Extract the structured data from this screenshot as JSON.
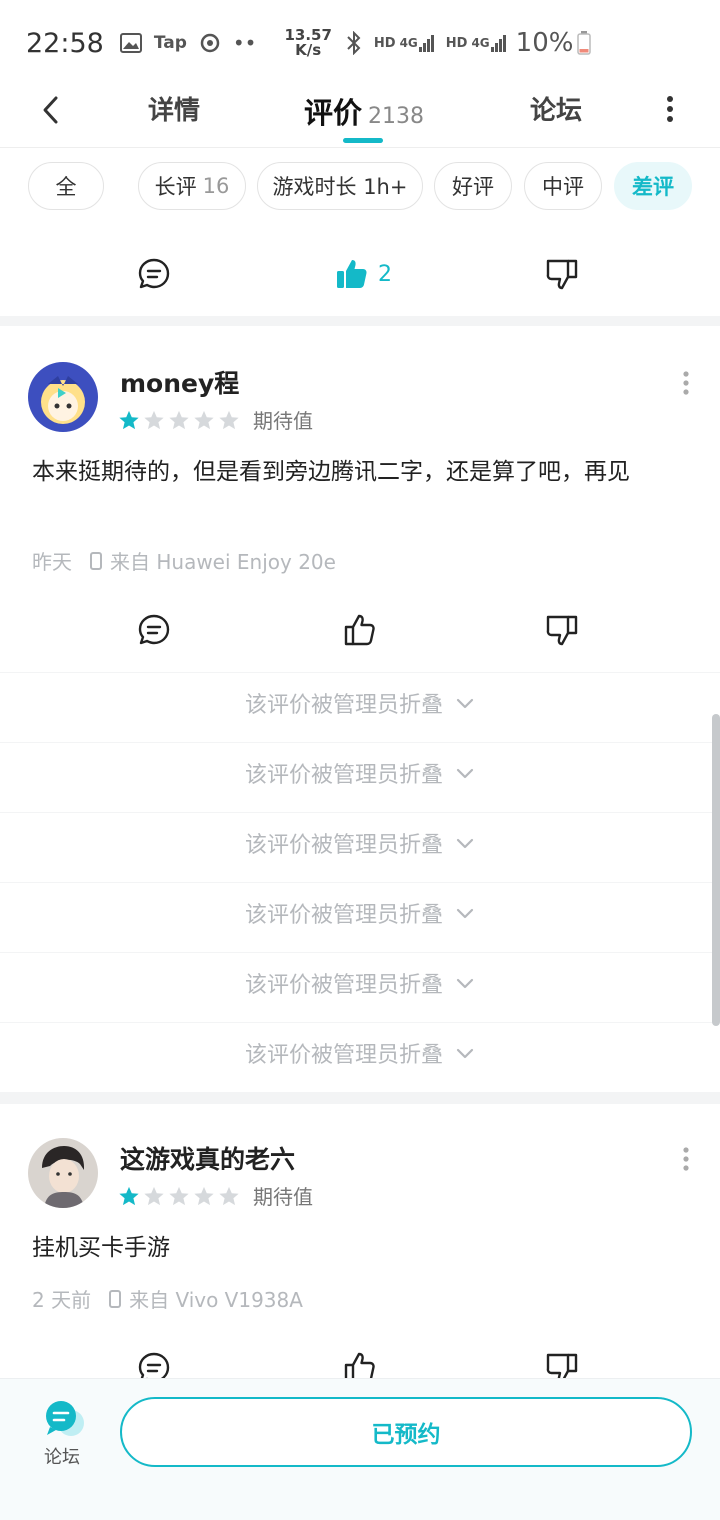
{
  "status_bar": {
    "time": "22:58",
    "app_label": "Tap",
    "speed_value": "13.57",
    "speed_unit": "K/s",
    "hd1": "HD",
    "net1": "4G",
    "hd2": "HD",
    "net2": "4G",
    "battery": "10%"
  },
  "nav": {
    "tab_details": "详情",
    "tab_reviews": "评价",
    "reviews_count": "2138",
    "tab_forum": "论坛"
  },
  "filters": [
    {
      "label": "全",
      "count": ""
    },
    {
      "label": "长评",
      "count": "16"
    },
    {
      "label": "游戏时长 1h+",
      "count": ""
    },
    {
      "label": "好评",
      "count": ""
    },
    {
      "label": "中评",
      "count": ""
    },
    {
      "label": "差评",
      "count": "",
      "active": true
    }
  ],
  "top_actions": {
    "like_count": "2"
  },
  "reviews": [
    {
      "username": "money程",
      "rating": 1,
      "rating_label": "期待值",
      "text": "本来挺期待的，但是看到旁边腾讯二字，还是算了吧，再见",
      "time": "昨天",
      "device": "来自 Huawei Enjoy 20e"
    },
    {
      "username": "这游戏真的老六",
      "rating": 1,
      "rating_label": "期待值",
      "text": "挂机买卡手游",
      "time": "2 天前",
      "device": "来自 Vivo V1938A"
    }
  ],
  "folded_label": "该评价被管理员折叠",
  "bottom_bar": {
    "forum_label": "论坛",
    "reserve_button": "已预约"
  },
  "colors": {
    "accent": "#14b9c8",
    "star_off": "#d6d9dc",
    "muted_text": "#b5b8bc",
    "gap": "#f3f4f5"
  }
}
